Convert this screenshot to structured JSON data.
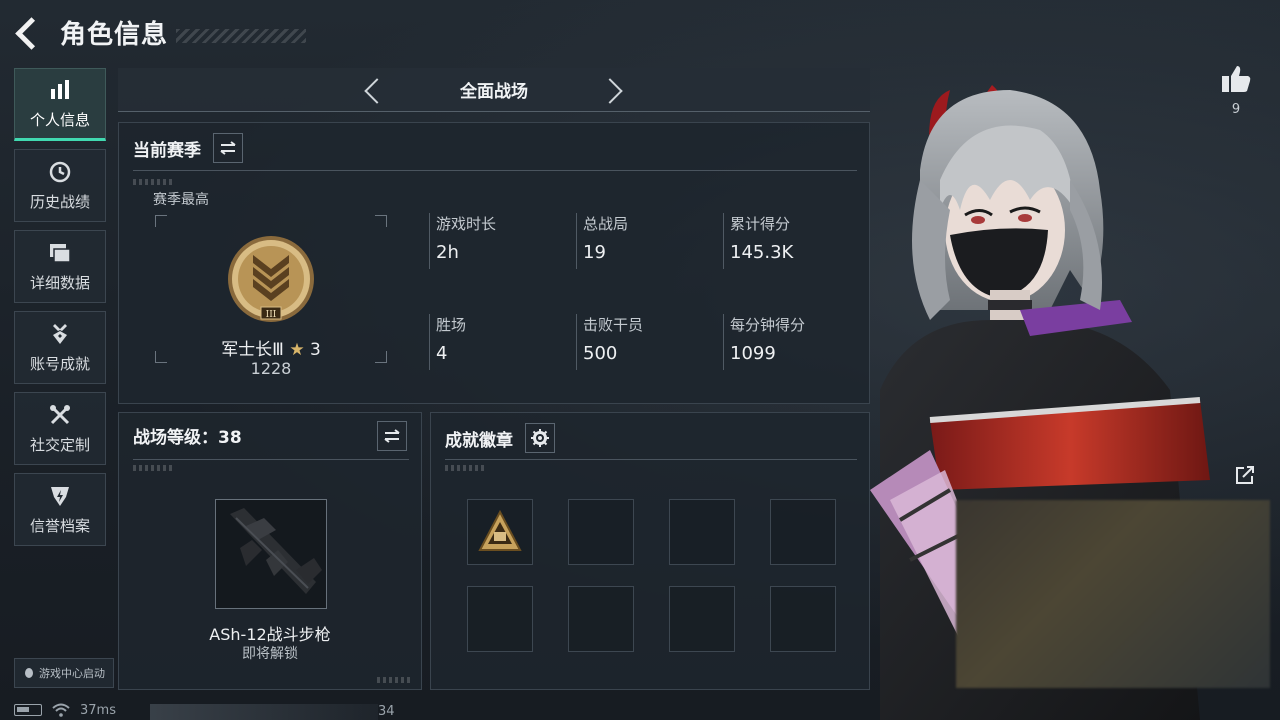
{
  "header": {
    "title": "角色信息"
  },
  "nav": {
    "items": [
      {
        "label": "个人信息",
        "icon": "bar-chart-icon",
        "active": true
      },
      {
        "label": "历史战绩",
        "icon": "clock-icon",
        "active": false
      },
      {
        "label": "详细数据",
        "icon": "folder-icon",
        "active": false
      },
      {
        "label": "账号成就",
        "icon": "medal-icon",
        "active": false
      },
      {
        "label": "社交定制",
        "icon": "tools-icon",
        "active": false
      },
      {
        "label": "信誉档案",
        "icon": "shield-icon",
        "active": false
      }
    ],
    "game_center": "游戏中心启动"
  },
  "status": {
    "latency": "37ms",
    "right_number": "34"
  },
  "mode": {
    "title": "全面战场"
  },
  "season": {
    "title": "当前赛季",
    "best_label": "赛季最高",
    "rank_name": "军士长Ⅲ",
    "rank_star_glyph": "★",
    "rank_stars": "3",
    "rank_points": "1228",
    "stats": [
      {
        "label": "游戏时长",
        "value": "2h"
      },
      {
        "label": "总战局",
        "value": "19"
      },
      {
        "label": "累计得分",
        "value": "145.3K"
      },
      {
        "label": "胜场",
        "value": "4"
      },
      {
        "label": "击败干员",
        "value": "500"
      },
      {
        "label": "每分钟得分",
        "value": "1099"
      }
    ]
  },
  "battlefield_level": {
    "title": "战场等级：38",
    "weapon_name": "ASh-12战斗步枪",
    "weapon_status": "即将解锁"
  },
  "achievements": {
    "title": "成就徽章"
  },
  "social": {
    "like_count": "9"
  },
  "colors": {
    "accent": "#41d9b0",
    "gold": "#c7a25c",
    "panel": "#1e252d"
  }
}
